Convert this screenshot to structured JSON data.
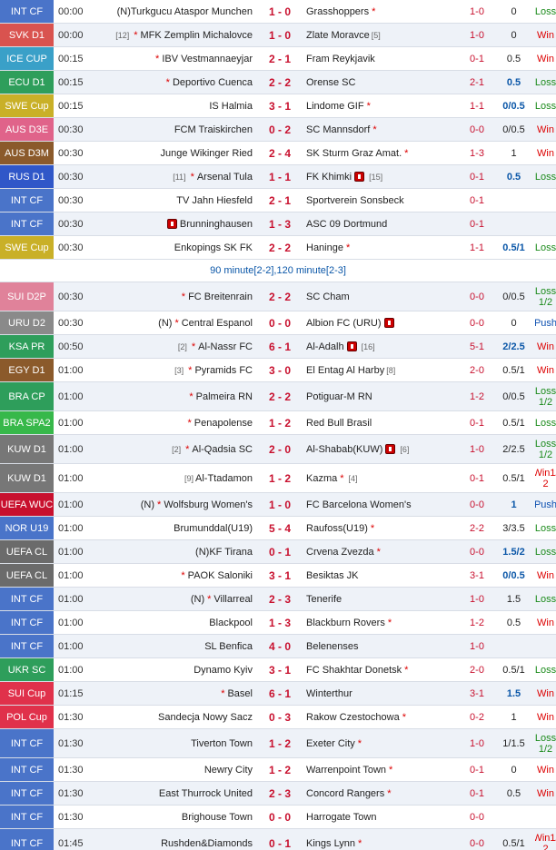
{
  "colors": {
    "INT CF": "#4a74c9",
    "SVK D1": "#d9534f",
    "ICE CUP": "#3aa0c8",
    "ECU D1": "#2e9e5b",
    "SWE Cup": "#c9b028",
    "AUS D3E": "#e0638a",
    "AUS D3M": "#8b5a2b",
    "RUS D1": "#3057c8",
    "SUI D2P": "#e0829a",
    "URU D2": "#8a8a8a",
    "KSA PR": "#2e9e5b",
    "EGY D1": "#8b5a2b",
    "BRA CP": "#2e9e5b",
    "BRA SPA2": "#37b84a",
    "KUW D1": "#777777",
    "UEFA WUC": "#c8102e",
    "NOR U19": "#4a74c9",
    "UEFA CL": "#6b6b6b",
    "UKR SC": "#2e9e5b",
    "SUI Cup": "#e0314b",
    "POL Cup": "#e0314b"
  },
  "rows": [
    {
      "league": "INT CF",
      "time": "00:00",
      "hpre": "(N) ",
      "home": "Turkgucu Ataspor Munchen",
      "score": "1 - 0",
      "away": "Grasshoppers",
      "astar": true,
      "ht": "1-0",
      "odds": "0",
      "res": "Loss"
    },
    {
      "league": "SVK D1",
      "time": "00:00",
      "hrank": "[12]",
      "hstar": true,
      "home": "MFK Zemplin Michalovce",
      "score": "1 - 0",
      "away": "Zlate Moravce",
      "arank": "[5]",
      "ht": "1-0",
      "odds": "0",
      "res": "Win"
    },
    {
      "league": "ICE CUP",
      "time": "00:15",
      "hstar": true,
      "home": "IBV Vestmannaeyjar",
      "score": "2 - 1",
      "away": "Fram Reykjavik",
      "ht": "0-1",
      "odds": "0.5",
      "res": "Win"
    },
    {
      "league": "ECU D1",
      "time": "00:15",
      "hstar": true,
      "home": "Deportivo Cuenca",
      "score": "2 - 2",
      "away": "Orense SC",
      "ht": "2-1",
      "odds": "0.5",
      "ob": true,
      "res": "Loss"
    },
    {
      "league": "SWE Cup",
      "time": "00:15",
      "home": "IS Halmia",
      "score": "3 - 1",
      "away": "Lindome GIF",
      "astar": true,
      "ht": "1-1",
      "odds": "0/0.5",
      "ob": true,
      "res": "Loss"
    },
    {
      "league": "AUS D3E",
      "time": "00:30",
      "home": "FCM Traiskirchen",
      "score": "0 - 2",
      "away": "SC Mannsdorf",
      "astar": true,
      "ht": "0-0",
      "odds": "0/0.5",
      "res": "Win"
    },
    {
      "league": "AUS D3M",
      "time": "00:30",
      "home": "Junge Wikinger Ried",
      "score": "2 - 4",
      "away": "SK Sturm Graz Amat.",
      "astar": true,
      "ht": "1-3",
      "odds": "1",
      "res": "Win"
    },
    {
      "league": "RUS D1",
      "time": "00:30",
      "hrank": "[11]",
      "hstar": true,
      "home": "Arsenal Tula",
      "score": "1 - 1",
      "away": "FK Khimki",
      "acard": true,
      "arank": "[15]",
      "ht": "0-1",
      "odds": "0.5",
      "ob": true,
      "res": "Loss"
    },
    {
      "league": "INT CF",
      "time": "00:30",
      "home": "TV Jahn Hiesfeld",
      "score": "2 - 1",
      "away": "Sportverein Sonsbeck",
      "ht": "0-1",
      "odds": "",
      "res": ""
    },
    {
      "league": "INT CF",
      "time": "00:30",
      "hcard": true,
      "home": "Brunninghausen",
      "score": "1 - 3",
      "away": "ASC 09 Dortmund",
      "ht": "0-1",
      "odds": "",
      "res": ""
    },
    {
      "league": "SWE Cup",
      "time": "00:30",
      "home": "Enkopings SK FK",
      "score": "2 - 2",
      "away": "Haninge",
      "astar": true,
      "ht": "1-1",
      "odds": "0.5/1",
      "ob": true,
      "res": "Loss"
    },
    {
      "note": "90 minute[2-2],120 minute[2-3]"
    },
    {
      "league": "SUI D2P",
      "time": "00:30",
      "hstar": true,
      "home": "FC Breitenrain",
      "score": "2 - 2",
      "away": "SC Cham",
      "ht": "0-0",
      "odds": "0/0.5",
      "res": "Loss 1/2",
      "h": 32
    },
    {
      "league": "URU D2",
      "time": "00:30",
      "hpre": "(N) ",
      "hstar": true,
      "home": "Central Espanol",
      "score": "0 - 0",
      "away": "Albion FC (URU)",
      "acard": true,
      "ht": "0-0",
      "odds": "0",
      "res": "Push"
    },
    {
      "league": "KSA PR",
      "time": "00:50",
      "hrank": "[2]",
      "hstar": true,
      "home": "Al-Nassr FC",
      "score": "6 - 1",
      "away": "Al-Adalh",
      "acard": true,
      "arank": "[16]",
      "ht": "5-1",
      "odds": "2/2.5",
      "ob": true,
      "res": "Win"
    },
    {
      "league": "EGY D1",
      "time": "01:00",
      "hrank": "[3]",
      "hstar": true,
      "home": "Pyramids FC",
      "score": "3 - 0",
      "away": "El Entag Al Harby",
      "arank": "[8]",
      "ht": "2-0",
      "odds": "0.5/1",
      "res": "Win"
    },
    {
      "league": "BRA CP",
      "time": "01:00",
      "hstar": true,
      "home": "Palmeira RN",
      "score": "2 - 2",
      "away": "Potiguar-M RN",
      "ht": "1-2",
      "odds": "0/0.5",
      "res": "Loss 1/2",
      "h": 32
    },
    {
      "league": "BRA SPA2",
      "time": "01:00",
      "hstar": true,
      "home": "Penapolense",
      "score": "1 - 2",
      "away": "Red Bull Brasil",
      "ht": "0-1",
      "odds": "0.5/1",
      "res": "Loss"
    },
    {
      "league": "KUW D1",
      "time": "01:00",
      "hrank": "[2]",
      "hstar": true,
      "home": "Al-Qadsia SC",
      "score": "2 - 0",
      "away": "Al-Shabab(KUW)",
      "acard": true,
      "arank": "[6]",
      "ht": "1-0",
      "odds": "2/2.5",
      "res": "Loss 1/2",
      "h": 32
    },
    {
      "league": "KUW D1",
      "time": "01:00",
      "hrank": "[9]",
      "home": "Al-Ttadamon",
      "score": "1 - 2",
      "away": "Kazma",
      "astar": true,
      "arank": "[4]",
      "ht": "0-1",
      "odds": "0.5/1",
      "res": "Win1/ 2",
      "h": 32
    },
    {
      "league": "UEFA WUC",
      "time": "01:00",
      "hpre": "(N) ",
      "hstar": true,
      "home": "Wolfsburg Women's",
      "score": "1 - 0",
      "away": "FC Barcelona Women's",
      "ht": "0-0",
      "odds": "1",
      "ob": true,
      "res": "Push"
    },
    {
      "league": "NOR U19",
      "time": "01:00",
      "home": "Brumunddal(U19)",
      "score": "5 - 4",
      "away": "Raufoss(U19)",
      "astar": true,
      "ht": "2-2",
      "odds": "3/3.5",
      "res": "Loss"
    },
    {
      "league": "UEFA CL",
      "time": "01:00",
      "hpre": "(N) ",
      "home": "KF Tirana",
      "score": "0 - 1",
      "away": "Crvena Zvezda",
      "astar": true,
      "ht": "0-0",
      "odds": "1.5/2",
      "ob": true,
      "res": "Loss"
    },
    {
      "league": "UEFA CL",
      "time": "01:00",
      "hstar": true,
      "home": "PAOK Saloniki",
      "score": "3 - 1",
      "away": "Besiktas JK",
      "ht": "3-1",
      "odds": "0/0.5",
      "ob": true,
      "res": "Win"
    },
    {
      "league": "INT CF",
      "time": "01:00",
      "hpre": "(N) ",
      "hstar": true,
      "home": "Villarreal",
      "score": "2 - 3",
      "away": "Tenerife",
      "ht": "1-0",
      "odds": "1.5",
      "res": "Loss"
    },
    {
      "league": "INT CF",
      "time": "01:00",
      "home": "Blackpool",
      "score": "1 - 3",
      "away": "Blackburn Rovers",
      "astar": true,
      "ht": "1-2",
      "odds": "0.5",
      "res": "Win"
    },
    {
      "league": "INT CF",
      "time": "01:00",
      "home": "SL Benfica",
      "score": "4 - 0",
      "away": "Belenenses",
      "ht": "1-0",
      "odds": "",
      "res": ""
    },
    {
      "league": "UKR SC",
      "time": "01:00",
      "home": "Dynamo Kyiv",
      "score": "3 - 1",
      "away": "FC Shakhtar Donetsk",
      "astar": true,
      "ht": "2-0",
      "odds": "0.5/1",
      "res": "Loss"
    },
    {
      "league": "SUI Cup",
      "time": "01:15",
      "hstar": true,
      "home": "Basel",
      "score": "6 - 1",
      "away": "Winterthur",
      "ht": "3-1",
      "odds": "1.5",
      "ob": true,
      "res": "Win"
    },
    {
      "league": "POL Cup",
      "time": "01:30",
      "home": "Sandecja Nowy Sacz",
      "score": "0 - 3",
      "away": "Rakow Czestochowa",
      "astar": true,
      "ht": "0-2",
      "odds": "1",
      "res": "Win"
    },
    {
      "league": "INT CF",
      "time": "01:30",
      "home": "Tiverton Town",
      "score": "1 - 2",
      "away": "Exeter City",
      "astar": true,
      "ht": "1-0",
      "odds": "1/1.5",
      "res": "Loss 1/2",
      "h": 32
    },
    {
      "league": "INT CF",
      "time": "01:30",
      "home": "Newry City",
      "score": "1 - 2",
      "away": "Warrenpoint Town",
      "astar": true,
      "ht": "0-1",
      "odds": "0",
      "res": "Win"
    },
    {
      "league": "INT CF",
      "time": "01:30",
      "home": "East Thurrock United",
      "score": "2 - 3",
      "away": "Concord Rangers",
      "astar": true,
      "ht": "0-1",
      "odds": "0.5",
      "res": "Win"
    },
    {
      "league": "INT CF",
      "time": "01:30",
      "home": "Brighouse Town",
      "score": "0 - 0",
      "away": "Harrogate Town",
      "ht": "0-0",
      "odds": "",
      "res": ""
    },
    {
      "league": "INT CF",
      "time": "01:45",
      "home": "Rushden&Diamonds",
      "score": "0 - 1",
      "away": "Kings Lynn",
      "astar": true,
      "ht": "0-0",
      "odds": "0.5/1",
      "res": "Win1/ 2",
      "h": 32
    }
  ]
}
